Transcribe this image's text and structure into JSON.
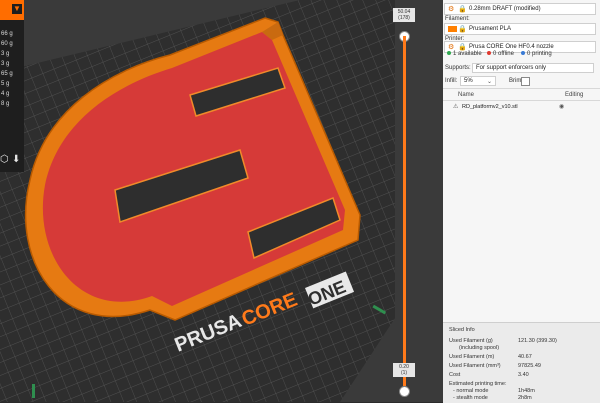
{
  "left_panel": {
    "weights": [
      "66 g",
      "60 g",
      "3 g",
      "3 g",
      "65 g",
      "5 g",
      "4 g",
      "8 g"
    ]
  },
  "scene": {
    "brand_prefix": "PRUSA",
    "brand_core": "CORE",
    "brand_one": "ONE",
    "bed_color": "#2e2e2e",
    "model_color": "#ff7f00",
    "highlight_color": "#d63a38"
  },
  "layer_slider": {
    "top_value": "50.04",
    "top_layer": "(178)",
    "bottom_value": "0.20",
    "bottom_layer": "(1)"
  },
  "sidebar": {
    "print_profile": "0.28mm DRAFT (modified)",
    "filament_label": "Filament:",
    "filament": "Prusament PLA",
    "filament_color": "#ff7f00",
    "printer_label": "Printer:",
    "printer": "Prusa CORE One HF0.4 nozzle",
    "status_available": "1 available",
    "status_offline": "0 offline",
    "status_printing": "0 printing",
    "supports_label": "Supports:",
    "supports_value": "For support enforcers only",
    "infill_label": "Infill:",
    "infill_value": "5%",
    "brim_label": "Brim:",
    "col_name": "Name",
    "col_editing": "Editing",
    "object_name": "RD_platformv2_v10.stl"
  },
  "sliced": {
    "title": "Sliced Info",
    "rows": [
      {
        "label": "Used Filament (g)",
        "sub": "(including spool)",
        "value": "121.30 (399.30)"
      },
      {
        "label": "Used Filament (m)",
        "value": "40.67"
      },
      {
        "label": "Used Filament (mm³)",
        "value": "97825.49"
      },
      {
        "label": "Cost",
        "value": "3.40"
      }
    ],
    "time_label": "Estimated printing time:",
    "normal_label": "- normal mode",
    "normal_value": "1h48m",
    "stealth_label": "- stealth mode",
    "stealth_value": "2h8m"
  }
}
